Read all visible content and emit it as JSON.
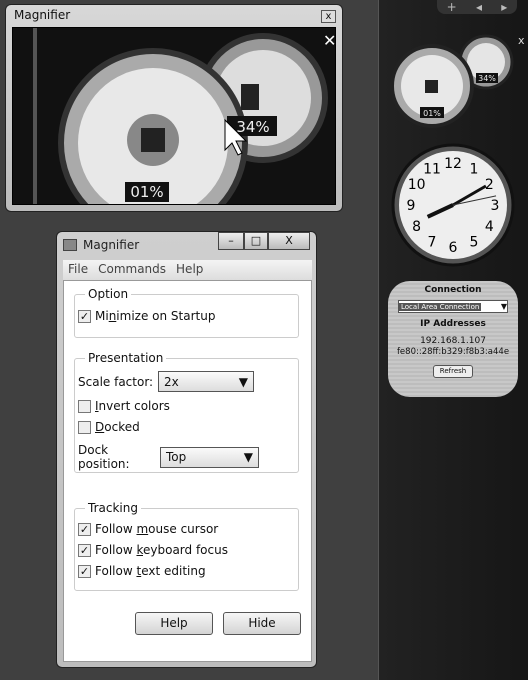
{
  "magnifier_window": {
    "title": "Magnifier",
    "close": "x",
    "zoom_texts": {
      "left_gauge": "01%",
      "right_gauge": "34%"
    }
  },
  "dialog": {
    "title": "Magnifier",
    "caption_buttons": {
      "minimize": "–",
      "maximize": "□",
      "close": "X"
    },
    "menu": [
      "File",
      "Commands",
      "Help"
    ],
    "option": {
      "legend": "Option",
      "minimize_startup": {
        "pre": "Mi",
        "u": "n",
        "post": "imize on Startup",
        "checked": true
      }
    },
    "presentation": {
      "legend": "Presentation",
      "scale_label": "Scale factor:",
      "scale_value": "2x",
      "invert": {
        "u": "I",
        "post": "nvert colors",
        "checked": false
      },
      "docked": {
        "u": "D",
        "post": "ocked",
        "checked": false
      },
      "dock_label": "Dock position:",
      "dock_value": "Top"
    },
    "tracking": {
      "legend": "Tracking",
      "mouse": {
        "pre": "Follow ",
        "u": "m",
        "post": "ouse cursor",
        "checked": true
      },
      "keyboard": {
        "pre": "Follow ",
        "u": "k",
        "post": "eyboard focus",
        "checked": true
      },
      "text": {
        "pre": "Follow ",
        "u": "t",
        "post": "ext editing",
        "checked": true
      }
    },
    "help_button": "Help",
    "hide_button": "Hide"
  },
  "sidebar": {
    "add": "+",
    "prev": "◂",
    "next": "▸",
    "close": "x",
    "cpu_gadget": {
      "cpu": "01%",
      "memory": "34%"
    },
    "clock": {
      "hour": 8,
      "minute": 10,
      "second": 13,
      "numbers": [
        "12",
        "1",
        "2",
        "3",
        "4",
        "5",
        "6",
        "7",
        "8",
        "9",
        "10",
        "11"
      ]
    },
    "network": {
      "title": "Connection",
      "connection": "Local Area Connection",
      "ip_label": "IP Addresses",
      "ipv4": "192.168.1.107",
      "ipv6": "fe80::28ff:b329:f8b3:a44e",
      "refresh": "Refresh"
    }
  }
}
